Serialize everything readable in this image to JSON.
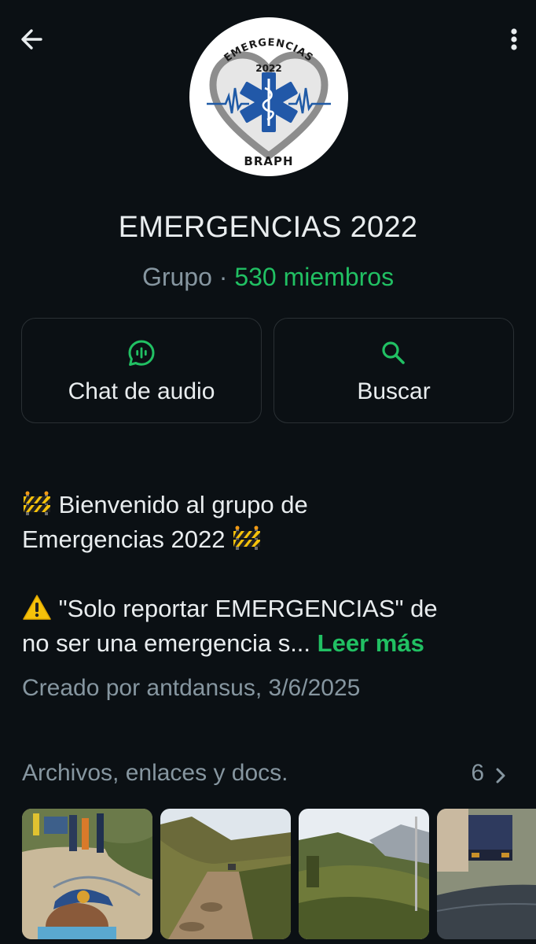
{
  "header": {
    "back_icon": "arrow-left-icon",
    "menu_icon": "more-vertical-icon"
  },
  "avatar": {
    "text_top": "EMERGENCIAS",
    "text_year": "2022",
    "text_bottom": "BRAPH",
    "icon": "star-of-life-icon"
  },
  "group": {
    "name": "EMERGENCIAS 2022",
    "kind": "Grupo",
    "separator": "·",
    "members": "530 miembros"
  },
  "actions": [
    {
      "label": "Chat de audio",
      "icon": "audio-chat-icon"
    },
    {
      "label": "Buscar",
      "icon": "search-icon"
    }
  ],
  "description": {
    "line1": "Bienvenido al grupo de",
    "line2": "Emergencias 2022",
    "line3": "\"Solo reportar EMERGENCIAS\" de",
    "line4": "no ser una emergencia s...",
    "read_more": "Leer más",
    "emoji_barrier": "construction-barrier-icon",
    "emoji_warning": "warning-icon"
  },
  "created": "Creado por antdansus, 3/6/2025",
  "files": {
    "title": "Archivos, enlaces y docs.",
    "count": "6",
    "chevron": "chevron-right-icon"
  },
  "colors": {
    "background": "#0b1014",
    "accent": "#21c063",
    "muted": "#8696a0",
    "text": "#e9edef"
  }
}
